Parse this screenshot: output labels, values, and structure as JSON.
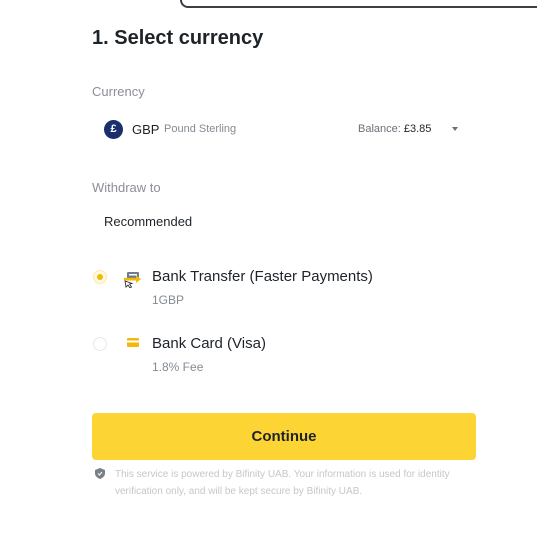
{
  "title": "1. Select currency",
  "currency": {
    "label": "Currency",
    "icon_symbol": "£",
    "code": "GBP",
    "name": "Pound Sterling",
    "balance_label": "Balance:",
    "balance_value": "£3.85",
    "icon": "pound-coin-icon"
  },
  "withdraw": {
    "label": "Withdraw to",
    "recommended_label": "Recommended",
    "options": [
      {
        "title": "Bank Transfer (Faster Payments)",
        "subtitle": "1GBP",
        "selected": true,
        "icon": "bank-transfer-icon"
      },
      {
        "title": "Bank Card (Visa)",
        "subtitle": "1.8% Fee",
        "selected": false,
        "icon": "card-icon"
      }
    ]
  },
  "continue_label": "Continue",
  "notice": "This service is powered by Bifinity UAB. Your information is used for identity verification only, and will be kept secure by Bifinity UAB.",
  "colors": {
    "accent": "#fcd535",
    "radio_selected": "#f0b90b",
    "text_primary": "#1e2329",
    "text_secondary": "#848b93"
  }
}
